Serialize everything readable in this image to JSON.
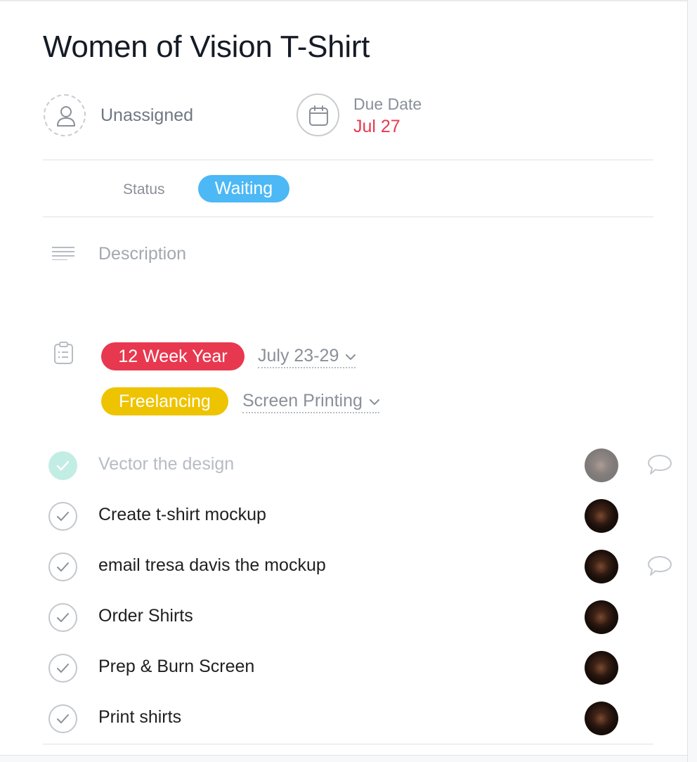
{
  "task": {
    "title": "Women of Vision T-Shirt",
    "assignee": "Unassigned",
    "due_date_label": "Due Date",
    "due_date_value": "Jul 27",
    "status_label": "Status",
    "status_value": "Waiting",
    "description_placeholder": "Description"
  },
  "projects": [
    {
      "tag": "12 Week Year",
      "tag_color": "#e8384f",
      "section": "July 23-29"
    },
    {
      "tag": "Freelancing",
      "tag_color": "#eec300",
      "section": "Screen Printing"
    }
  ],
  "subtasks": [
    {
      "name": "Vector the design",
      "completed": true,
      "has_comment": true
    },
    {
      "name": "Create t-shirt mockup",
      "completed": false,
      "has_comment": false
    },
    {
      "name": "email tresa davis the mockup",
      "completed": false,
      "has_comment": true
    },
    {
      "name": "Order Shirts",
      "completed": false,
      "has_comment": false
    },
    {
      "name": "Prep & Burn Screen",
      "completed": false,
      "has_comment": false
    },
    {
      "name": "Print shirts",
      "completed": false,
      "has_comment": false
    }
  ],
  "colors": {
    "due_date": "#e8384f",
    "status_pill": "#4cb8f5",
    "completed_check": "#c2ede4"
  },
  "icons": {
    "assignee": "person-icon",
    "due_date": "calendar-icon",
    "description": "text-lines-icon",
    "projects": "clipboard-list-icon",
    "section_dropdown": "chevron-down-icon",
    "subtask_check": "check-icon",
    "comment": "speech-bubble-icon"
  }
}
